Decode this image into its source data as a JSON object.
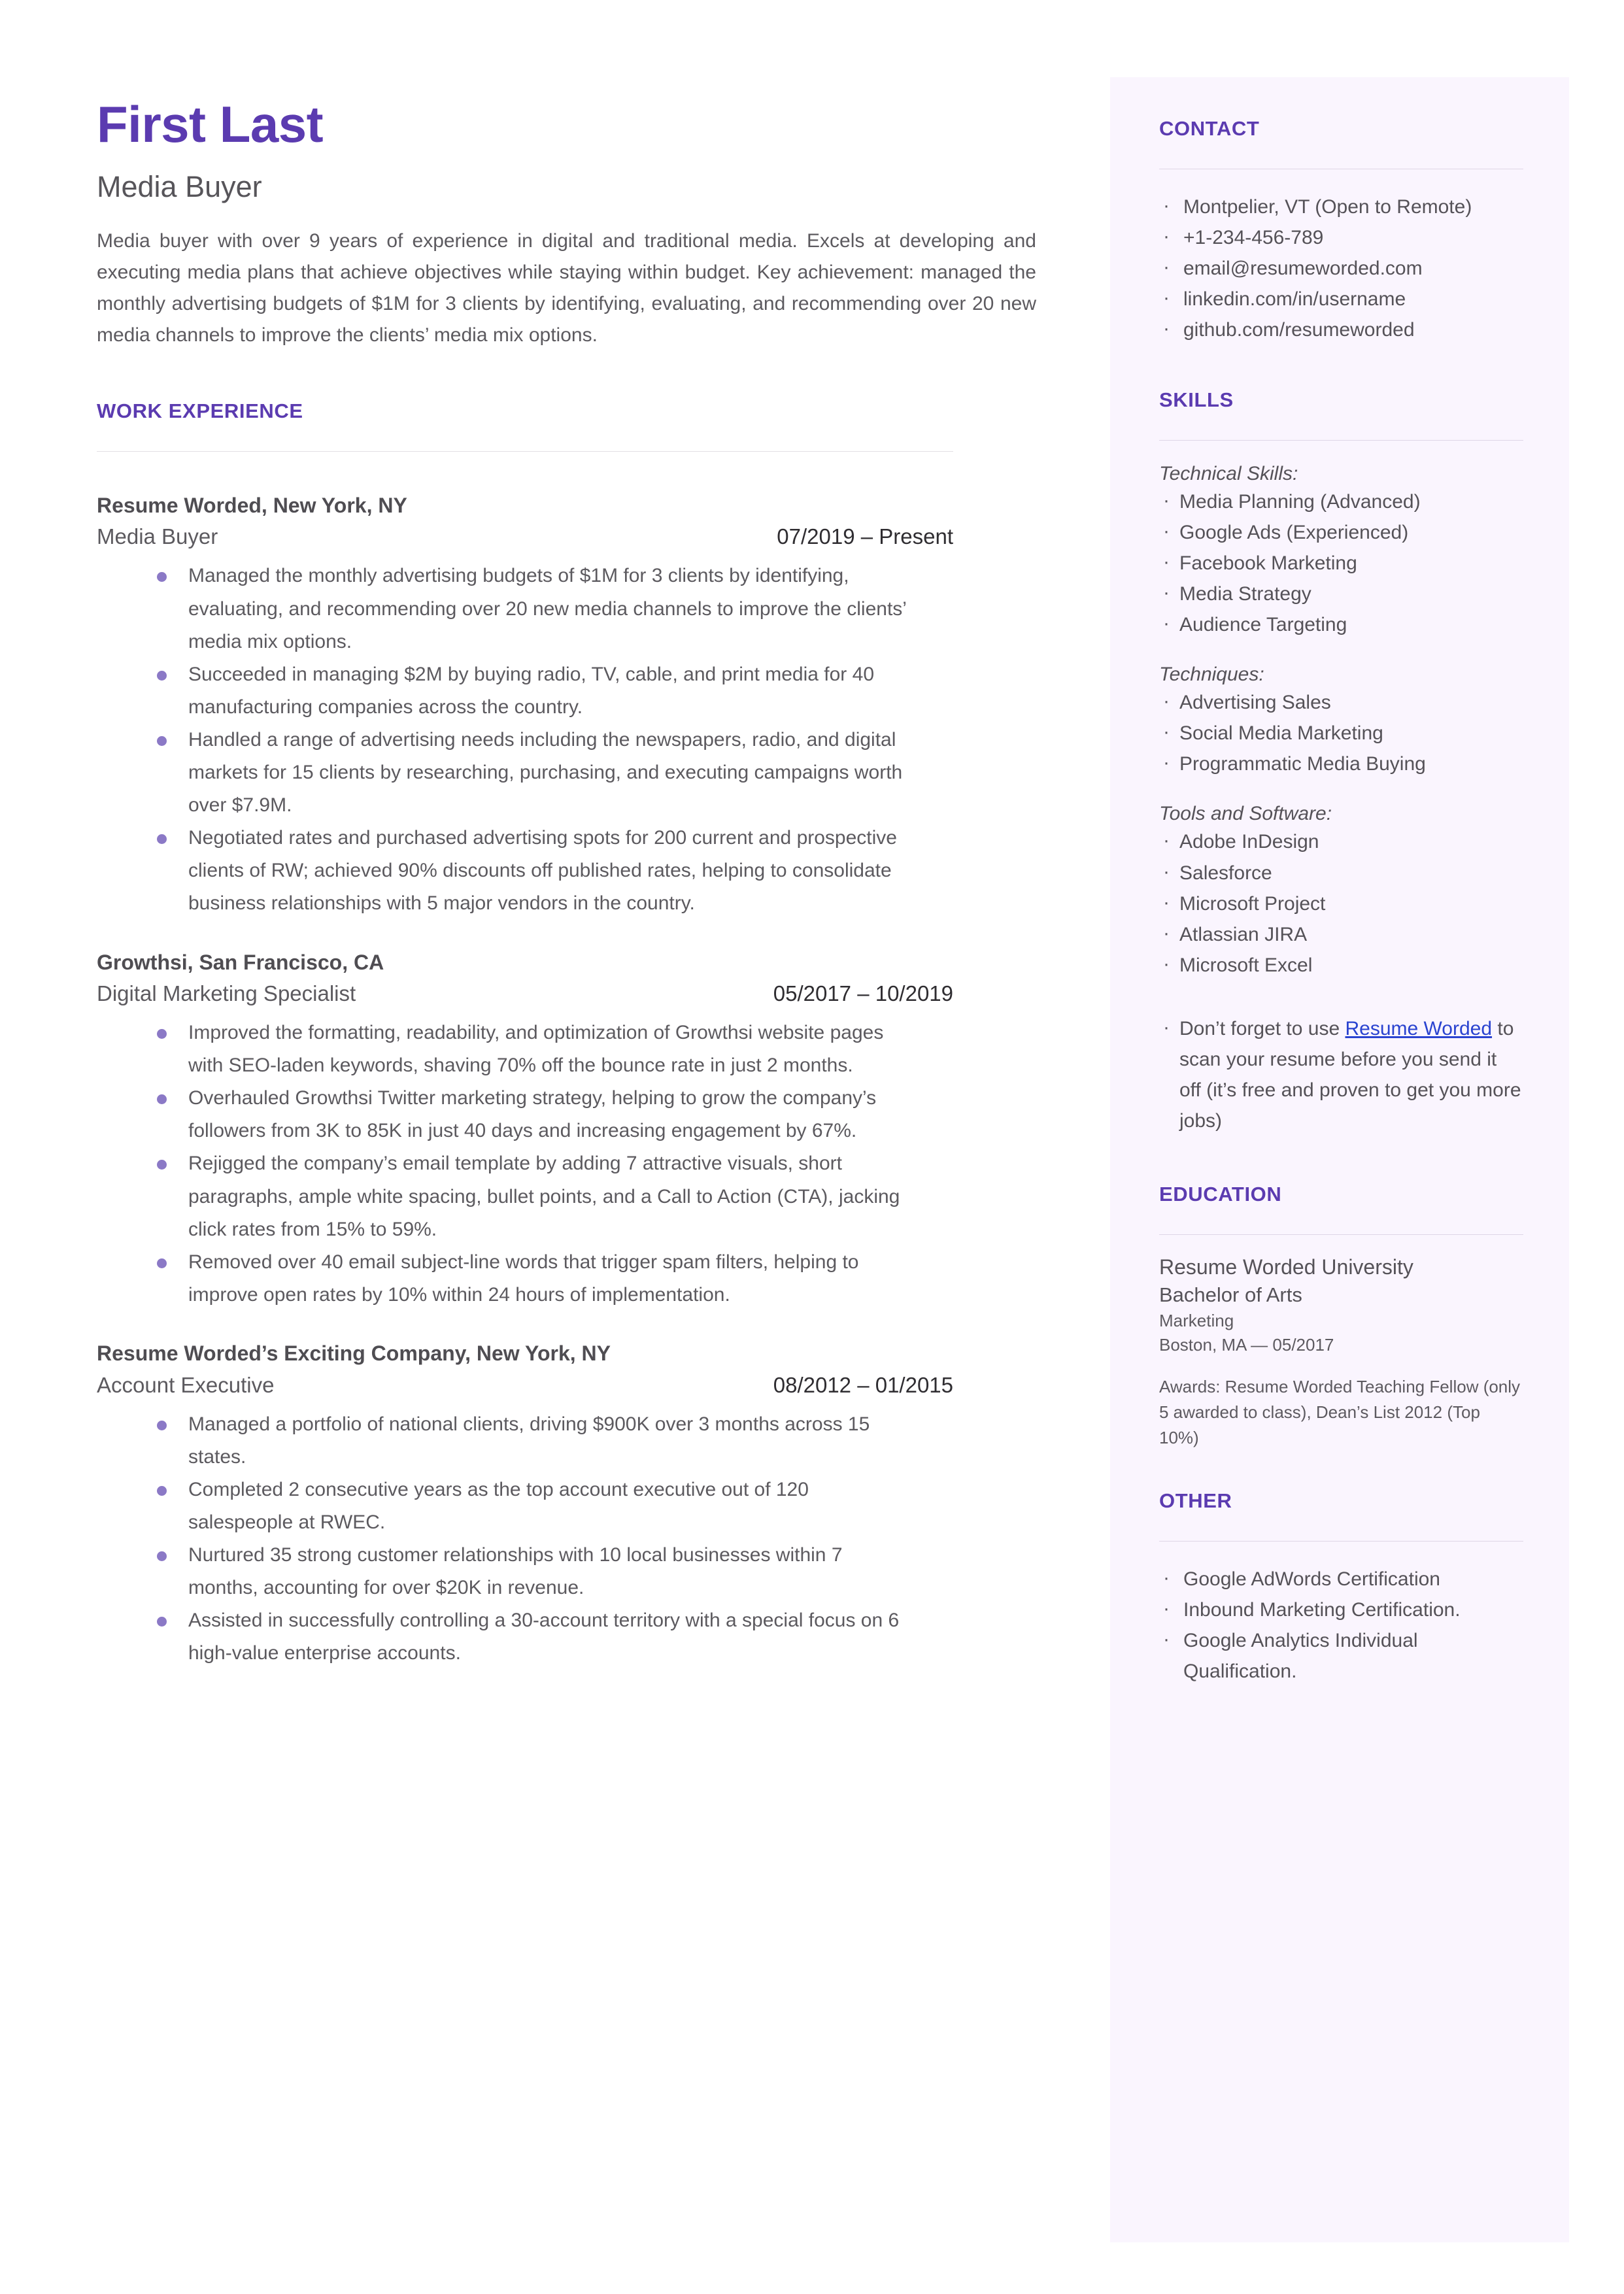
{
  "theme": {
    "accent": "#5b3bb0",
    "bullet": "#8b79c6",
    "sidebar_bg": "#faf5fe",
    "body_text": "#5c5a5f",
    "link": "#2a43d0"
  },
  "header": {
    "name": "First Last",
    "role": "Media Buyer",
    "summary": "Media buyer with over 9 years of experience in digital and traditional media. Excels at developing and executing media plans that achieve objectives while staying within budget. Key achievement: managed the monthly advertising budgets of $1M for 3 clients by identifying, evaluating, and recommending over 20 new media channels to improve the clients’ media mix options."
  },
  "work_experience": {
    "heading": "WORK EXPERIENCE",
    "jobs": [
      {
        "company": "Resume Worded, New York, NY",
        "title": "Media Buyer",
        "dates": "07/2019 – Present",
        "bullets": [
          "Managed the monthly advertising budgets of $1M for 3 clients by identifying, evaluating, and recommending over 20 new media channels to improve the clients’ media mix options.",
          "Succeeded in managing $2M by buying radio, TV, cable, and print media for 40 manufacturing companies across the country.",
          "Handled a range of advertising needs including the newspapers, radio, and digital markets for 15 clients by researching, purchasing, and executing campaigns worth over $7.9M.",
          "Negotiated rates and purchased advertising spots for 200 current and prospective clients of RW; achieved 90% discounts off published rates, helping to consolidate business relationships with 5 major vendors in the country."
        ]
      },
      {
        "company": "Growthsi, San Francisco, CA",
        "title": "Digital Marketing Specialist",
        "dates": "05/2017 – 10/2019",
        "bullets": [
          "Improved the formatting, readability, and optimization of Growthsi website pages with SEO-laden keywords, shaving 70% off the bounce rate in just 2 months.",
          "Overhauled Growthsi Twitter marketing strategy, helping to grow the company’s followers from 3K to 85K in just 40 days and increasing engagement by 67%.",
          "Rejigged the company’s email template by adding 7 attractive visuals, short paragraphs, ample white spacing, bullet points, and a Call to Action (CTA), jacking click rates from 15% to 59%.",
          "Removed over 40 email subject-line words that trigger spam filters, helping to improve open rates by 10% within 24 hours of implementation."
        ]
      },
      {
        "company": "Resume Worded’s Exciting Company, New York, NY",
        "title": "Account Executive",
        "dates": "08/2012 – 01/2015",
        "bullets": [
          "Managed a portfolio of national clients, driving $900K over 3 months across 15 states.",
          "Completed 2 consecutive years as the top account executive out of 120 salespeople at RWEC.",
          "Nurtured 35 strong customer relationships with 10 local businesses within 7 months, accounting for over $20K in revenue.",
          "Assisted in successfully controlling a 30-account territory with a special focus on 6 high-value enterprise accounts."
        ]
      }
    ]
  },
  "sidebar": {
    "contact": {
      "heading": "CONTACT",
      "items": [
        "Montpelier, VT (Open to Remote)",
        "+1-234-456-789",
        "email@resumeworded.com",
        "linkedin.com/in/username",
        "github.com/resumeworded"
      ]
    },
    "skills": {
      "heading": "SKILLS",
      "groups": [
        {
          "label": "Technical Skills:",
          "items": [
            "Media Planning (Advanced)",
            "Google Ads (Experienced)",
            "Facebook Marketing",
            "Media Strategy",
            "Audience Targeting"
          ]
        },
        {
          "label": "Techniques:",
          "items": [
            "Advertising Sales",
            "Social Media Marketing",
            "Programmatic Media Buying"
          ]
        },
        {
          "label": "Tools and Software:",
          "items": [
            "Adobe InDesign",
            "Salesforce",
            "Microsoft Project",
            "Atlassian JIRA",
            "Microsoft Excel"
          ]
        }
      ],
      "note": {
        "prefix": "Don’t forget to use ",
        "link_text": "Resume Worded",
        "suffix": " to scan your resume before you send it off (it’s free and proven to get you more jobs)"
      }
    },
    "education": {
      "heading": "EDUCATION",
      "school": "Resume Worded University",
      "degree": "Bachelor of Arts",
      "field": "Marketing",
      "location_date": "Boston, MA — 05/2017",
      "awards": "Awards: Resume Worded Teaching Fellow (only 5 awarded to class), Dean’s List 2012 (Top 10%)"
    },
    "other": {
      "heading": "OTHER",
      "items": [
        "Google AdWords Certification",
        "Inbound Marketing Certification.",
        "Google Analytics Individual Qualification."
      ]
    }
  }
}
